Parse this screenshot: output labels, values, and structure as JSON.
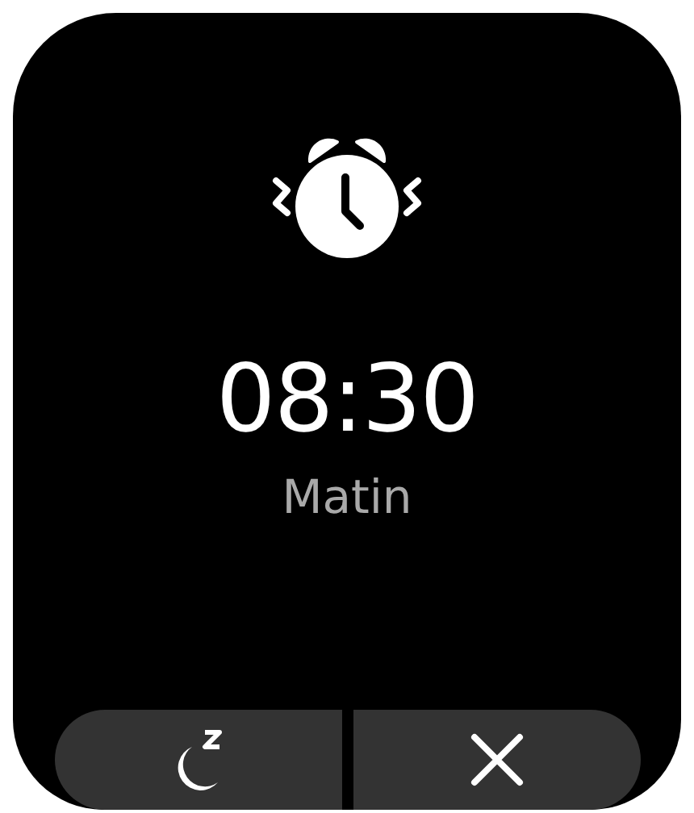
{
  "alarm": {
    "time": "08:30",
    "period": "Matin"
  },
  "buttons": [
    {
      "kind": "snooze"
    },
    {
      "kind": "dismiss"
    }
  ]
}
